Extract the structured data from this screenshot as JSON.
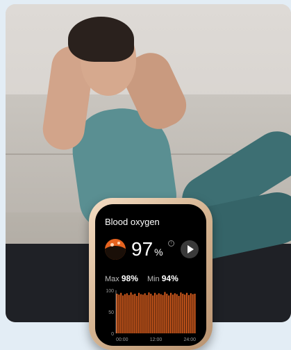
{
  "watch": {
    "title": "Blood oxygen",
    "value": "97",
    "unit": "%",
    "max_label": "Max",
    "max_value": "98%",
    "min_label": "Min",
    "min_value": "94%"
  },
  "chart_data": {
    "type": "bar",
    "x_ticks": [
      "00:00",
      "12:00",
      "24:00"
    ],
    "y_ticks": [
      "100",
      "50",
      "0"
    ],
    "ylim": [
      0,
      100
    ],
    "values": [
      92,
      90,
      94,
      88,
      91,
      93,
      89,
      95,
      90,
      92,
      87,
      94,
      91,
      90,
      93,
      89,
      95,
      92,
      88,
      94,
      90,
      93,
      91,
      89,
      96,
      92,
      88,
      94,
      90,
      93,
      91,
      87,
      95,
      92,
      90,
      94,
      89,
      93,
      91,
      92
    ],
    "bar_color": "#e6631f",
    "axis_color": "#9a9a9a"
  },
  "colors": {
    "accent": "#e6631f",
    "screen": "#000000"
  }
}
